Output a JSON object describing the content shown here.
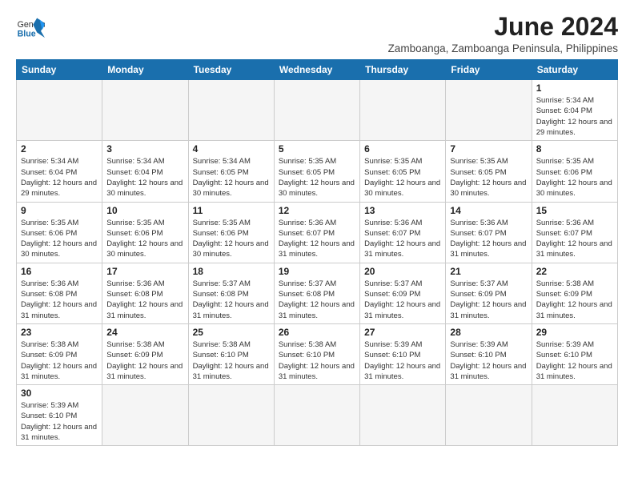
{
  "logo": {
    "text_general": "General",
    "text_blue": "Blue"
  },
  "title": "June 2024",
  "subtitle": "Zamboanga, Zamboanga Peninsula, Philippines",
  "days_of_week": [
    "Sunday",
    "Monday",
    "Tuesday",
    "Wednesday",
    "Thursday",
    "Friday",
    "Saturday"
  ],
  "weeks": [
    [
      {
        "day": "",
        "empty": true
      },
      {
        "day": "",
        "empty": true
      },
      {
        "day": "",
        "empty": true
      },
      {
        "day": "",
        "empty": true
      },
      {
        "day": "",
        "empty": true
      },
      {
        "day": "",
        "empty": true
      },
      {
        "day": "1",
        "info": "Sunrise: 5:34 AM\nSunset: 6:04 PM\nDaylight: 12 hours\nand 29 minutes."
      }
    ],
    [
      {
        "day": "2",
        "info": "Sunrise: 5:34 AM\nSunset: 6:04 PM\nDaylight: 12 hours\nand 29 minutes."
      },
      {
        "day": "3",
        "info": "Sunrise: 5:34 AM\nSunset: 6:04 PM\nDaylight: 12 hours\nand 30 minutes."
      },
      {
        "day": "4",
        "info": "Sunrise: 5:34 AM\nSunset: 6:05 PM\nDaylight: 12 hours\nand 30 minutes."
      },
      {
        "day": "5",
        "info": "Sunrise: 5:35 AM\nSunset: 6:05 PM\nDaylight: 12 hours\nand 30 minutes."
      },
      {
        "day": "6",
        "info": "Sunrise: 5:35 AM\nSunset: 6:05 PM\nDaylight: 12 hours\nand 30 minutes."
      },
      {
        "day": "7",
        "info": "Sunrise: 5:35 AM\nSunset: 6:05 PM\nDaylight: 12 hours\nand 30 minutes."
      },
      {
        "day": "8",
        "info": "Sunrise: 5:35 AM\nSunset: 6:06 PM\nDaylight: 12 hours\nand 30 minutes."
      }
    ],
    [
      {
        "day": "9",
        "info": "Sunrise: 5:35 AM\nSunset: 6:06 PM\nDaylight: 12 hours\nand 30 minutes."
      },
      {
        "day": "10",
        "info": "Sunrise: 5:35 AM\nSunset: 6:06 PM\nDaylight: 12 hours\nand 30 minutes."
      },
      {
        "day": "11",
        "info": "Sunrise: 5:35 AM\nSunset: 6:06 PM\nDaylight: 12 hours\nand 30 minutes."
      },
      {
        "day": "12",
        "info": "Sunrise: 5:36 AM\nSunset: 6:07 PM\nDaylight: 12 hours\nand 31 minutes."
      },
      {
        "day": "13",
        "info": "Sunrise: 5:36 AM\nSunset: 6:07 PM\nDaylight: 12 hours\nand 31 minutes."
      },
      {
        "day": "14",
        "info": "Sunrise: 5:36 AM\nSunset: 6:07 PM\nDaylight: 12 hours\nand 31 minutes."
      },
      {
        "day": "15",
        "info": "Sunrise: 5:36 AM\nSunset: 6:07 PM\nDaylight: 12 hours\nand 31 minutes."
      }
    ],
    [
      {
        "day": "16",
        "info": "Sunrise: 5:36 AM\nSunset: 6:08 PM\nDaylight: 12 hours\nand 31 minutes."
      },
      {
        "day": "17",
        "info": "Sunrise: 5:36 AM\nSunset: 6:08 PM\nDaylight: 12 hours\nand 31 minutes."
      },
      {
        "day": "18",
        "info": "Sunrise: 5:37 AM\nSunset: 6:08 PM\nDaylight: 12 hours\nand 31 minutes."
      },
      {
        "day": "19",
        "info": "Sunrise: 5:37 AM\nSunset: 6:08 PM\nDaylight: 12 hours\nand 31 minutes."
      },
      {
        "day": "20",
        "info": "Sunrise: 5:37 AM\nSunset: 6:09 PM\nDaylight: 12 hours\nand 31 minutes."
      },
      {
        "day": "21",
        "info": "Sunrise: 5:37 AM\nSunset: 6:09 PM\nDaylight: 12 hours\nand 31 minutes."
      },
      {
        "day": "22",
        "info": "Sunrise: 5:38 AM\nSunset: 6:09 PM\nDaylight: 12 hours\nand 31 minutes."
      }
    ],
    [
      {
        "day": "23",
        "info": "Sunrise: 5:38 AM\nSunset: 6:09 PM\nDaylight: 12 hours\nand 31 minutes."
      },
      {
        "day": "24",
        "info": "Sunrise: 5:38 AM\nSunset: 6:09 PM\nDaylight: 12 hours\nand 31 minutes."
      },
      {
        "day": "25",
        "info": "Sunrise: 5:38 AM\nSunset: 6:10 PM\nDaylight: 12 hours\nand 31 minutes."
      },
      {
        "day": "26",
        "info": "Sunrise: 5:38 AM\nSunset: 6:10 PM\nDaylight: 12 hours\nand 31 minutes."
      },
      {
        "day": "27",
        "info": "Sunrise: 5:39 AM\nSunset: 6:10 PM\nDaylight: 12 hours\nand 31 minutes."
      },
      {
        "day": "28",
        "info": "Sunrise: 5:39 AM\nSunset: 6:10 PM\nDaylight: 12 hours\nand 31 minutes."
      },
      {
        "day": "29",
        "info": "Sunrise: 5:39 AM\nSunset: 6:10 PM\nDaylight: 12 hours\nand 31 minutes."
      }
    ],
    [
      {
        "day": "30",
        "info": "Sunrise: 5:39 AM\nSunset: 6:10 PM\nDaylight: 12 hours\nand 31 minutes."
      },
      {
        "day": "",
        "empty": true
      },
      {
        "day": "",
        "empty": true
      },
      {
        "day": "",
        "empty": true
      },
      {
        "day": "",
        "empty": true
      },
      {
        "day": "",
        "empty": true
      },
      {
        "day": "",
        "empty": true
      }
    ]
  ]
}
